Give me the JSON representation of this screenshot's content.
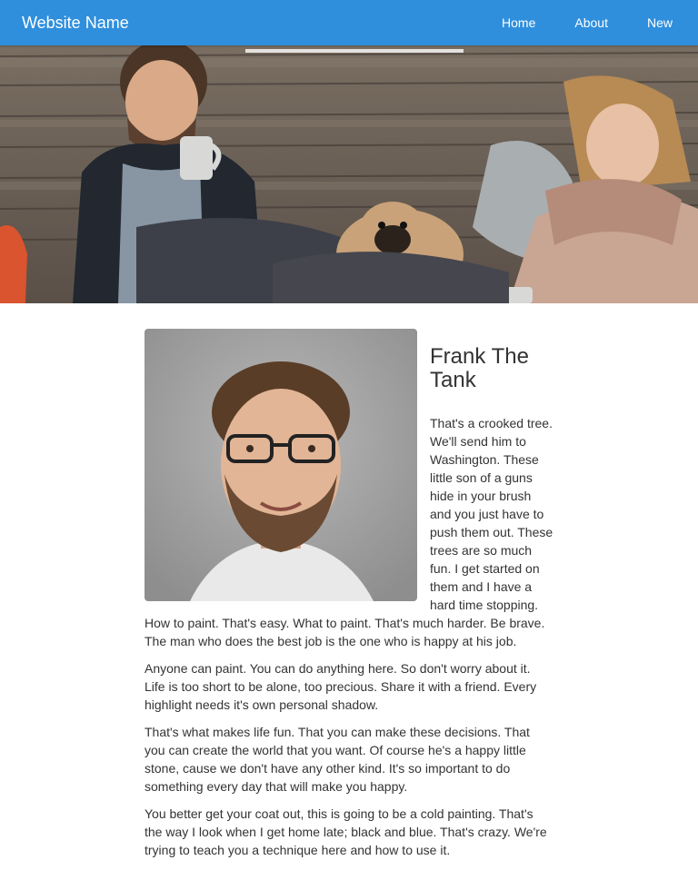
{
  "navbar": {
    "brand": "Website Name",
    "links": [
      "Home",
      "About",
      "New"
    ]
  },
  "hero": {
    "image_subject": "two people with coffee mugs and a pug sitting against a wooden fence"
  },
  "article": {
    "portrait_subject": "smiling bearded man with glasses",
    "title": "Frank The Tank",
    "paragraphs": [
      "That's a crooked tree. We'll send him to Washington. These little son of a guns hide in your brush and you just have to push them out. These trees are so much fun. I get started on them and I have a hard time stopping. How to paint. That's easy. What to paint. That's much harder. Be brave. The man who does the best job is the one who is happy at his job.",
      "Anyone can paint. You can do anything here. So don't worry about it. Life is too short to be alone, too precious. Share it with a friend. Every highlight needs it's own personal shadow.",
      "That's what makes life fun. That you can make these decisions. That you can create the world that you want. Of course he's a happy little stone, cause we don't have any other kind. It's so important to do something every day that will make you happy.",
      "You better get your coat out, this is going to be a cold painting. That's the way I look when I get home late; black and blue. That's crazy. We're trying to teach you a technique here and how to use it."
    ]
  },
  "colors": {
    "navbar_bg": "#2f8fdd",
    "nav_text": "#ffffff",
    "body_text": "#333333"
  }
}
